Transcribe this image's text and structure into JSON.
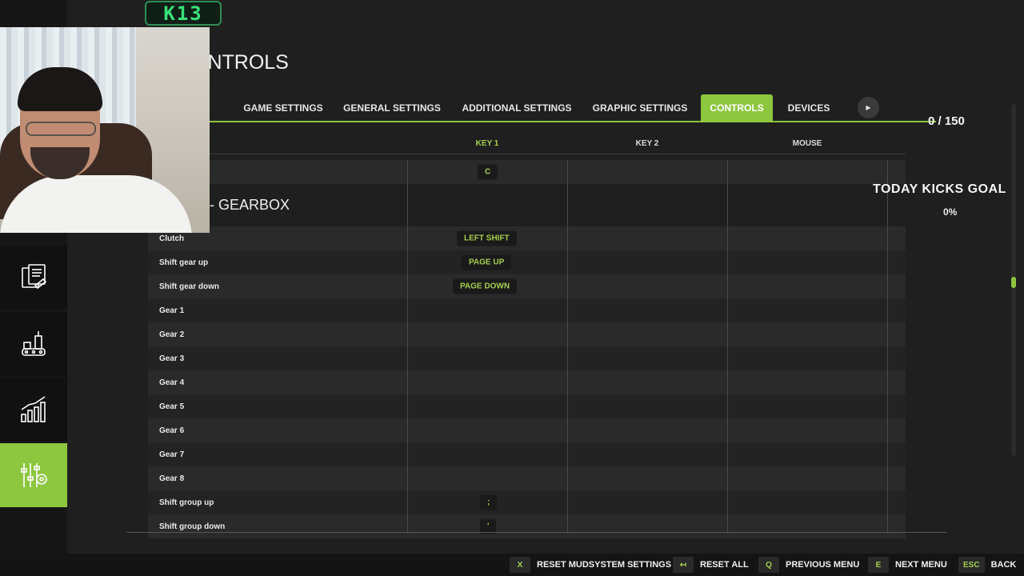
{
  "badge": "K13",
  "page_title": "ONTROLS",
  "tabs": [
    {
      "label": "GAME SETTINGS"
    },
    {
      "label": "GENERAL SETTINGS"
    },
    {
      "label": "ADDITIONAL SETTINGS"
    },
    {
      "label": "GRAPHIC SETTINGS"
    },
    {
      "label": "CONTROLS",
      "active": true
    },
    {
      "label": "DEVICES"
    }
  ],
  "columns": {
    "key1": "KEY 1",
    "key2": "KEY 2",
    "mouse": "MOUSE"
  },
  "previous_row": {
    "key1": "C"
  },
  "section_title": "- GEARBOX",
  "rows": [
    {
      "action": "Clutch",
      "key1": "LEFT SHIFT",
      "key2": "",
      "mouse": ""
    },
    {
      "action": "Shift gear up",
      "key1": "PAGE UP",
      "key2": "",
      "mouse": ""
    },
    {
      "action": "Shift gear down",
      "key1": "PAGE DOWN",
      "key2": "",
      "mouse": ""
    },
    {
      "action": "Gear 1",
      "key1": "",
      "key2": "",
      "mouse": ""
    },
    {
      "action": "Gear 2",
      "key1": "",
      "key2": "",
      "mouse": ""
    },
    {
      "action": "Gear 3",
      "key1": "",
      "key2": "",
      "mouse": ""
    },
    {
      "action": "Gear 4",
      "key1": "",
      "key2": "",
      "mouse": ""
    },
    {
      "action": "Gear 5",
      "key1": "",
      "key2": "",
      "mouse": ""
    },
    {
      "action": "Gear 6",
      "key1": "",
      "key2": "",
      "mouse": ""
    },
    {
      "action": "Gear 7",
      "key1": "",
      "key2": "",
      "mouse": ""
    },
    {
      "action": "Gear 8",
      "key1": "",
      "key2": "",
      "mouse": ""
    },
    {
      "action": "Shift group up",
      "key1": ";",
      "key2": "",
      "mouse": ""
    },
    {
      "action": "Shift group down",
      "key1": "'",
      "key2": "",
      "mouse": ""
    }
  ],
  "overlay": {
    "counter": "0 / 150",
    "goal_title": "TODAY KICKS GOAL",
    "goal_percent": "0%"
  },
  "footer_hints": [
    {
      "key": "X",
      "label": "RESET MUDSYSTEM SETTINGS"
    },
    {
      "key": "↤",
      "label": "RESET ALL"
    },
    {
      "key": "Q",
      "label": "PREVIOUS MENU"
    },
    {
      "key": "E",
      "label": "NEXT MENU"
    },
    {
      "key": "ESC",
      "label": "BACK"
    }
  ],
  "sidebar": [
    {
      "icon": "documents-icon"
    },
    {
      "icon": "factory-icon"
    },
    {
      "icon": "statistics-icon"
    },
    {
      "icon": "settings-sliders-icon",
      "active": true
    }
  ],
  "colors": {
    "accent": "#8dc63f",
    "key_text": "#a5cf4e",
    "background": "#1f1f1f"
  }
}
